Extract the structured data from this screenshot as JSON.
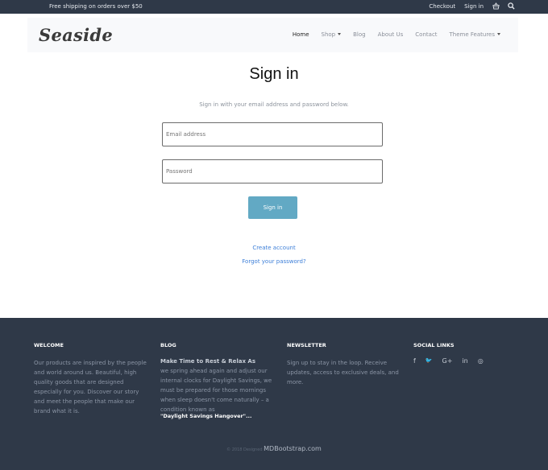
{
  "topbar": {
    "promo": "Free shipping on orders over $50",
    "checkout": "Checkout",
    "signin": "Sign in",
    "cart_icon": "basket-icon",
    "search_icon": "search-icon"
  },
  "navbar": {
    "logo": "Seaside",
    "items": [
      {
        "label": "Home"
      },
      {
        "label": "Shop"
      },
      {
        "label": "Blog"
      },
      {
        "label": "About Us"
      },
      {
        "label": "Contact"
      },
      {
        "label": "Theme Features"
      }
    ]
  },
  "main": {
    "title": "Sign in",
    "subtitle": "Sign in with your email address and password below.",
    "email_placeholder": "Email address",
    "password_placeholder": "Password",
    "signin_button": "Sign in",
    "create_account": "Create account",
    "forgot_password": "Forgot your password?"
  },
  "footer": {
    "welcome_title": "WELCOME",
    "welcome_text": "Our products are inspired by the people and world around us. Beautiful, high quality goods that are designed especially for you. Discover our story and meet the people that make our brand what it is.",
    "blog_title": "BLOG",
    "blog_post_title": "Make Time to Rest & Relax As",
    "blog_post_text": "we spring ahead again and adjust our internal clocks for Daylight Savings, we must be prepared for those mornings when sleep doesn't come naturally – a condition known as",
    "blog_post_end": "\"Daylight Savings Hangover\"...",
    "newsletter_title": "NEWSLETTER",
    "newsletter_text": "Sign up to stay in the loop. Receive updates, access to exclusive deals, and more.",
    "social_title": "SOCIAL LINKS",
    "social_icons": [
      "f",
      "🐦",
      "G+",
      "in",
      "◎"
    ],
    "copyright_prefix": "© 2018 Designed",
    "copyright_brand": "MDBootstrap.com"
  }
}
